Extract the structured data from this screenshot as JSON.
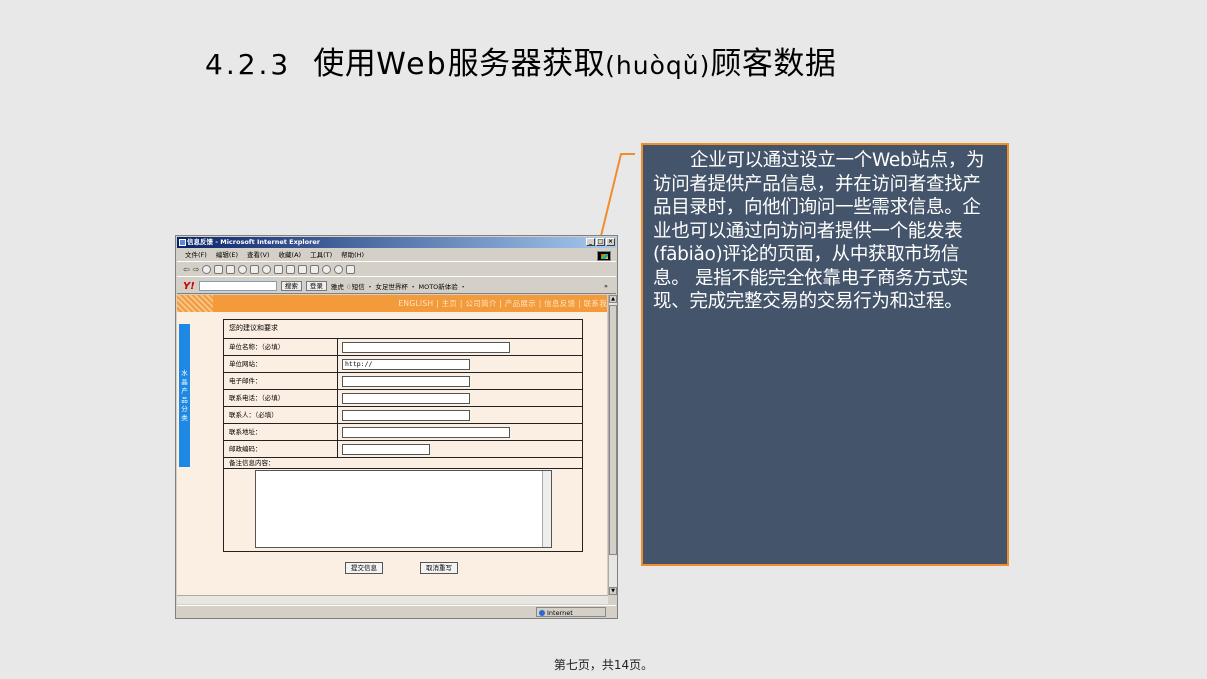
{
  "slide": {
    "title_number": "4.2.3",
    "title_pre": "使用",
    "title_latin": "Web",
    "title_mid": "服务器获取",
    "title_pinyin": "(huòqǔ)",
    "title_post": "顾客数据",
    "callout_text": "企业可以通过设立一个Web站点，为访问者提供产品信息，并在访问者查找产品目录时，向他们询问一些需求信息。企业也可以通过向访问者提供一个能发表(fābiǎo)评论的页面，从中获取市场信息。 是指不能完全依靠电子商务方式实现、完成完整交易的交易行为和过程。",
    "footer": "第七页，共14页。",
    "accent_color": "#f08e2e",
    "callout_bg": "#44546a"
  },
  "browser": {
    "window_title": "信息反馈 - Microsoft Internet Explorer",
    "menu": [
      "文件(F)",
      "编辑(E)",
      "查看(V)",
      "收藏(A)",
      "工具(T)",
      "帮助(H)"
    ],
    "yahoo_bar": {
      "search_btn": "搜索",
      "login_btn": "登录",
      "items": "雅虎  ♢短信 ・ 女足世界杯 ・ MOTO新体验 ・",
      "more": "»"
    },
    "site_nav": "ENGLISH | 主页 | 公司简介 | 产品展示 | 信息反馈 | 联系我",
    "side_tab": "水晶产品分类",
    "form": {
      "heading": "您的建议和要求",
      "rows": [
        {
          "label": "单位名称：（必填）",
          "value": ""
        },
        {
          "label": "单位网站：",
          "value": "http://"
        },
        {
          "label": "电子邮件：",
          "value": ""
        },
        {
          "label": "联系电话：（必填）",
          "value": ""
        },
        {
          "label": "联系人：（必填）",
          "value": ""
        },
        {
          "label": "联系地址：",
          "value": ""
        },
        {
          "label": "邮政编码：",
          "value": ""
        }
      ],
      "note_label": "备注信息内容：",
      "submit": "提交信息",
      "reset": "取消重写"
    },
    "status_zone": "Internet"
  }
}
